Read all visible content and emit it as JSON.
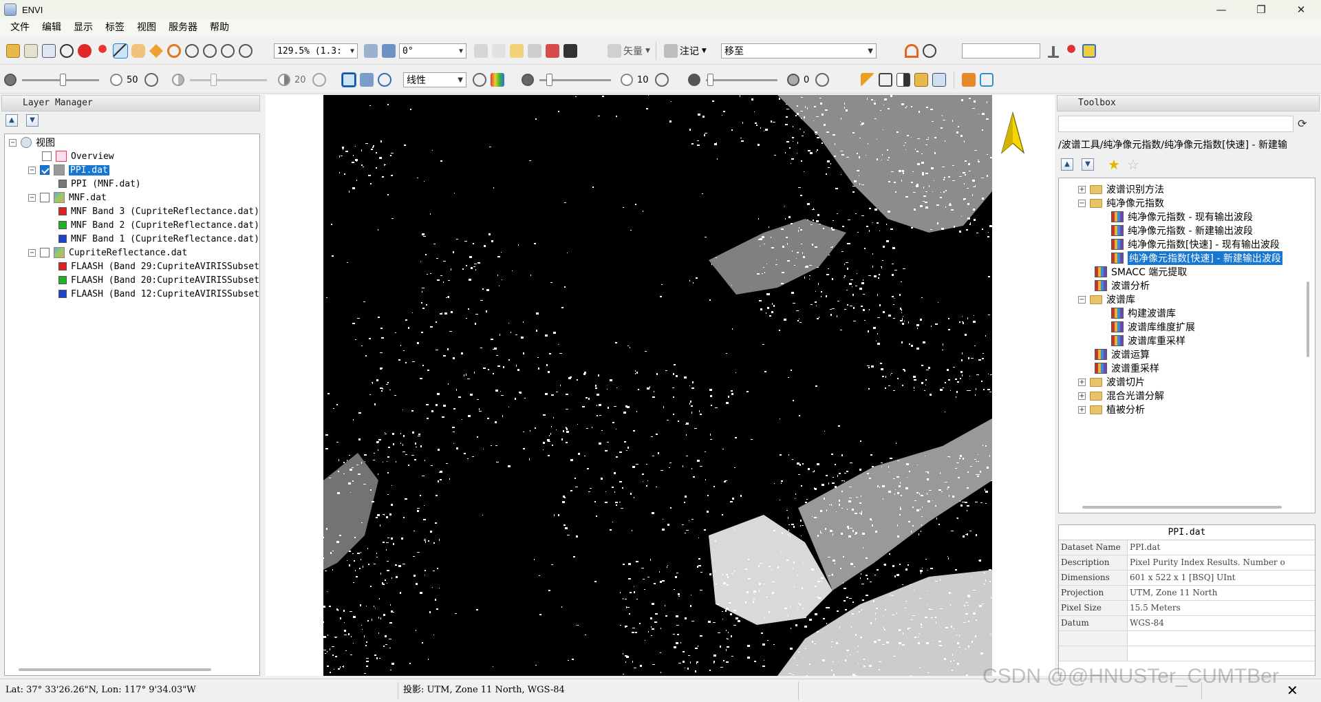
{
  "window": {
    "title": "ENVI"
  },
  "menubar": {
    "items": [
      "文件",
      "编辑",
      "显示",
      "标签",
      "视图",
      "服务器",
      "帮助"
    ]
  },
  "toolbar1": {
    "zoom_value": "129.5% (1.3:",
    "rotation_value": "0°",
    "vector_label": "矢量",
    "annotation_label": "注记",
    "goto_value": "移至",
    "search_value": ""
  },
  "toolbar2": {
    "brightness_value": "50",
    "contrast_value": "20",
    "stretch_value": "线性",
    "sharpen_value": "10",
    "transparency_value": "0"
  },
  "layer_manager": {
    "title": "Layer Manager",
    "tree": [
      {
        "label": "视图",
        "level": 0,
        "expander": "−",
        "checkbox": null,
        "icon": "view-icon"
      },
      {
        "label": "Overview",
        "level": 1,
        "checkbox": false,
        "icon": "overview-icon"
      },
      {
        "label": "PPI.dat",
        "level": 1,
        "expander": "−",
        "checkbox": true,
        "icon": "raster-icon",
        "selected": true
      },
      {
        "label": "PPI (MNF.dat)",
        "level": 2,
        "icon": "band-gray-swatch"
      },
      {
        "label": "MNF.dat",
        "level": 1,
        "expander": "−",
        "checkbox": false,
        "icon": "raster-color-icon"
      },
      {
        "label": "MNF Band 3 (CupriteReflectance.dat)",
        "level": 2,
        "color": "#e02020"
      },
      {
        "label": "MNF Band 2 (CupriteReflectance.dat)",
        "level": 2,
        "color": "#22b022"
      },
      {
        "label": "MNF Band 1 (CupriteReflectance.dat)",
        "level": 2,
        "color": "#2040d0"
      },
      {
        "label": "CupriteReflectance.dat",
        "level": 1,
        "expander": "−",
        "checkbox": false,
        "icon": "raster-color-icon"
      },
      {
        "label": "FLAASH (Band 29:CupriteAVIRISSubset.",
        "level": 2,
        "color": "#e02020"
      },
      {
        "label": "FLAASH (Band 20:CupriteAVIRISSubset.",
        "level": 2,
        "color": "#22b022"
      },
      {
        "label": "FLAASH (Band 12:CupriteAVIRISSubset.",
        "level": 2,
        "color": "#2040d0"
      }
    ]
  },
  "toolbox": {
    "title": "Toolbox",
    "path": "/波谱工具/纯净像元指数/纯净像元指数[快速] - 新建输",
    "tree": [
      {
        "label": "波谱识别方法",
        "level": 1,
        "type": "folder",
        "expander": "+"
      },
      {
        "label": "纯净像元指数",
        "level": 1,
        "type": "folder",
        "expander": "−"
      },
      {
        "label": "纯净像元指数 - 现有输出波段",
        "level": 2,
        "type": "tool"
      },
      {
        "label": "纯净像元指数 - 新建输出波段",
        "level": 2,
        "type": "tool"
      },
      {
        "label": "纯净像元指数[快速] - 现有输出波段",
        "level": 2,
        "type": "tool"
      },
      {
        "label": "纯净像元指数[快速] - 新建输出波段",
        "level": 2,
        "type": "tool",
        "selected": true
      },
      {
        "label": "SMACC 端元提取",
        "level": 1,
        "type": "tool"
      },
      {
        "label": "波谱分析",
        "level": 1,
        "type": "tool"
      },
      {
        "label": "波谱库",
        "level": 1,
        "type": "folder",
        "expander": "−"
      },
      {
        "label": "构建波谱库",
        "level": 2,
        "type": "tool"
      },
      {
        "label": "波谱库维度扩展",
        "level": 2,
        "type": "tool"
      },
      {
        "label": "波谱库重采样",
        "level": 2,
        "type": "tool"
      },
      {
        "label": "波谱运算",
        "level": 1,
        "type": "tool"
      },
      {
        "label": "波谱重采样",
        "level": 1,
        "type": "tool"
      },
      {
        "label": "波谱切片",
        "level": 1,
        "type": "folder",
        "expander": "+"
      },
      {
        "label": "混合光谱分解",
        "level": 1,
        "type": "folder",
        "expander": "+"
      },
      {
        "label": "植被分析",
        "level": 1,
        "type": "folder",
        "expander": "+"
      }
    ]
  },
  "properties": {
    "title": "PPI.dat",
    "rows": [
      {
        "key": "Dataset Name",
        "value": "PPI.dat"
      },
      {
        "key": "Description",
        "value": "Pixel Purity Index Results. Number o"
      },
      {
        "key": "Dimensions",
        "value": "601 x 522 x 1 [BSQ] UInt"
      },
      {
        "key": "Projection",
        "value": "UTM, Zone 11 North"
      },
      {
        "key": "Pixel Size",
        "value": "15.5 Meters"
      },
      {
        "key": "Datum",
        "value": "WGS-84"
      },
      {
        "key": "",
        "value": ""
      },
      {
        "key": "",
        "value": ""
      }
    ]
  },
  "statusbar": {
    "coords": "Lat: 37° 33'26.26\"N, Lon: 117° 9'34.03\"W",
    "projection": "投影:  UTM, Zone 11 North, WGS-84"
  },
  "watermark": "CSDN @@HNUSTer_CUMTBer",
  "colors": {
    "selection": "#1877d2",
    "image_bg": "#000000"
  }
}
